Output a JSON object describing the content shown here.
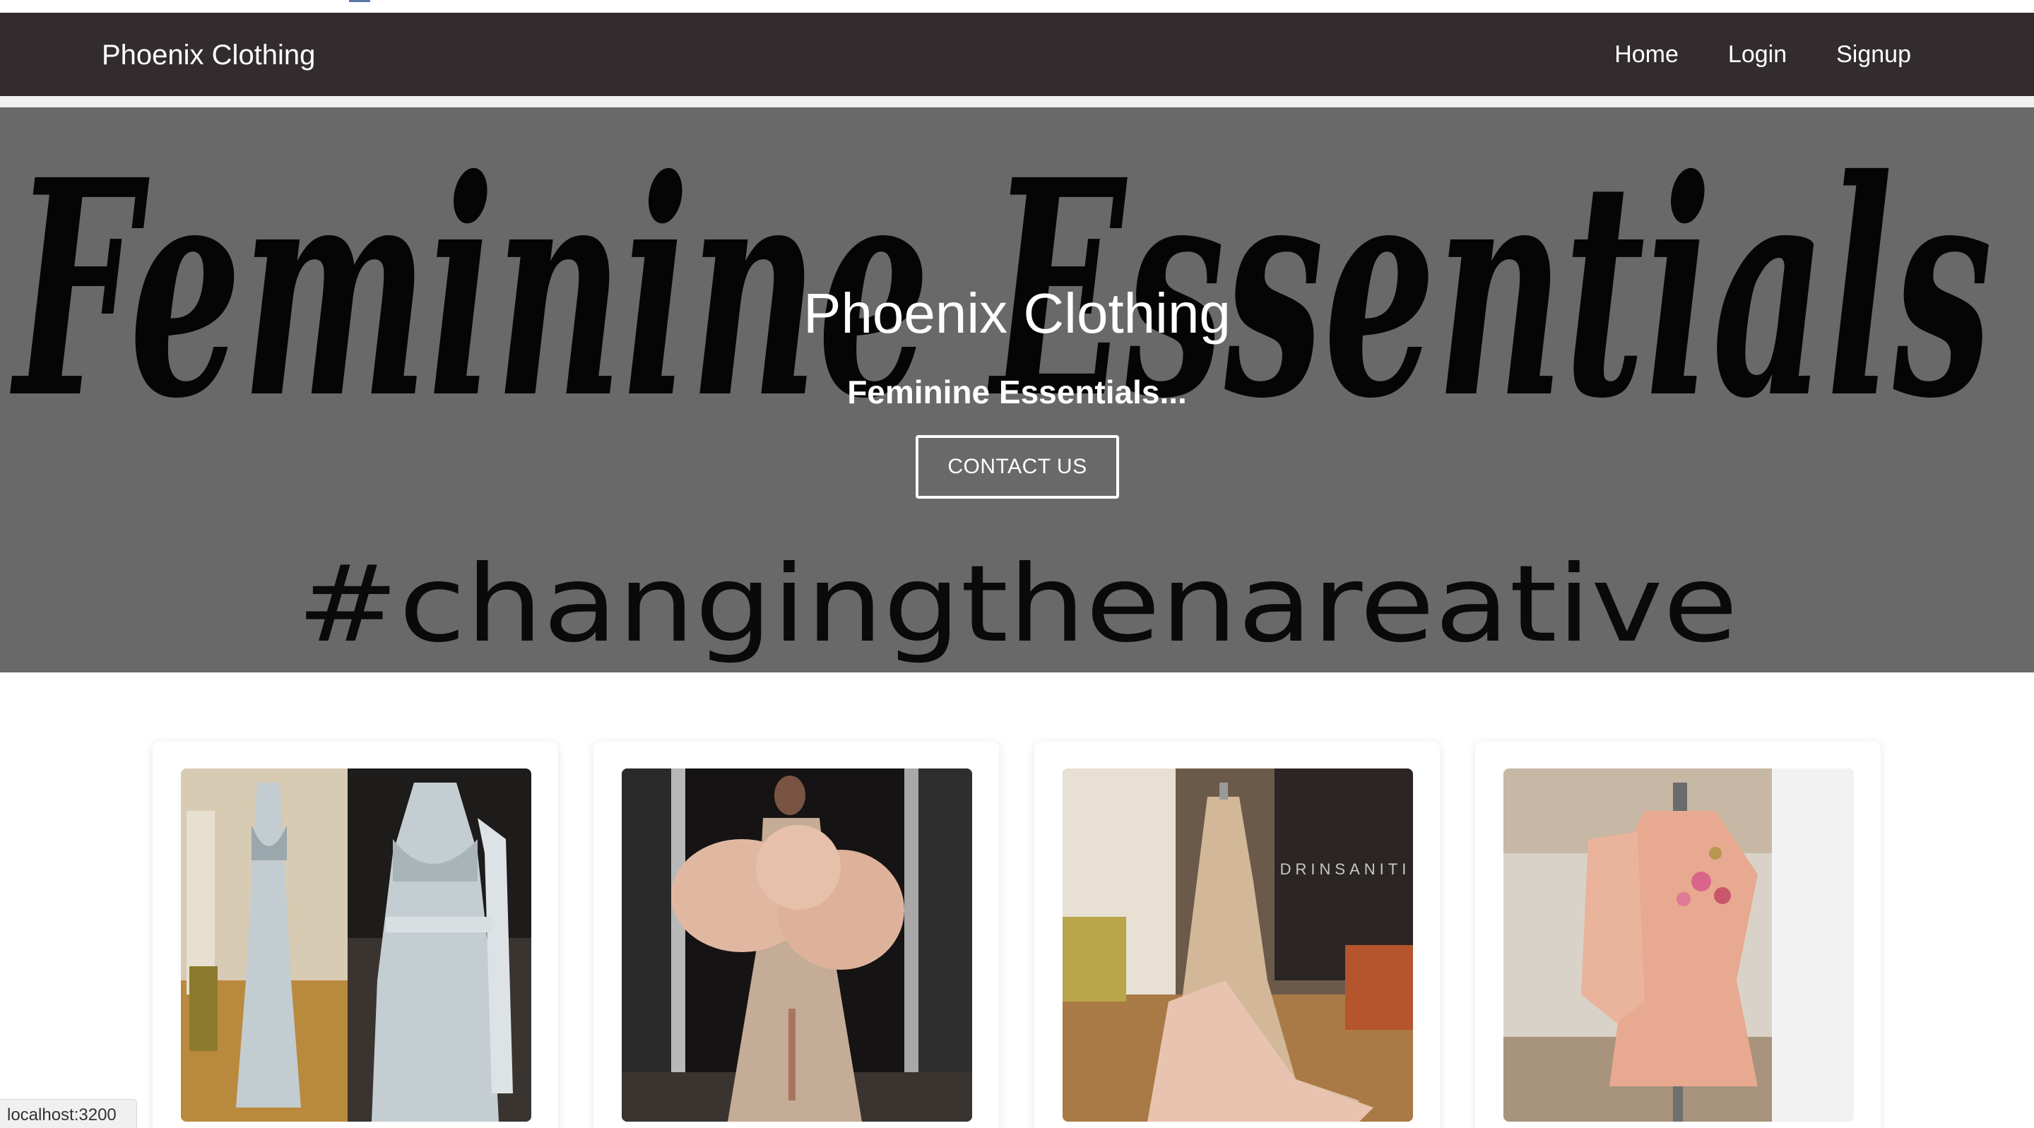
{
  "navbar": {
    "brand": "Phoenix Clothing",
    "links": [
      "Home",
      "Login",
      "Signup"
    ]
  },
  "hero": {
    "background_script_text": "Feminine Essentials",
    "background_hashtag": "#changingthenareative",
    "title": "Phoenix Clothing",
    "subtitle": "Feminine Essentials...",
    "cta_label": "CONTACT US"
  },
  "products": [
    {
      "image_icon": "dress-photo-pale-blue-gown"
    },
    {
      "image_icon": "dress-photo-feather-sleeve-gown"
    },
    {
      "image_icon": "dress-photo-feather-train-gown"
    },
    {
      "image_icon": "dress-photo-peach-mini-dress"
    }
  ],
  "status_bar": {
    "url": "localhost:3200"
  },
  "colors": {
    "navbar": "#322c2e",
    "hero_overlay": "#6a6969",
    "text_light": "#ffffff"
  }
}
